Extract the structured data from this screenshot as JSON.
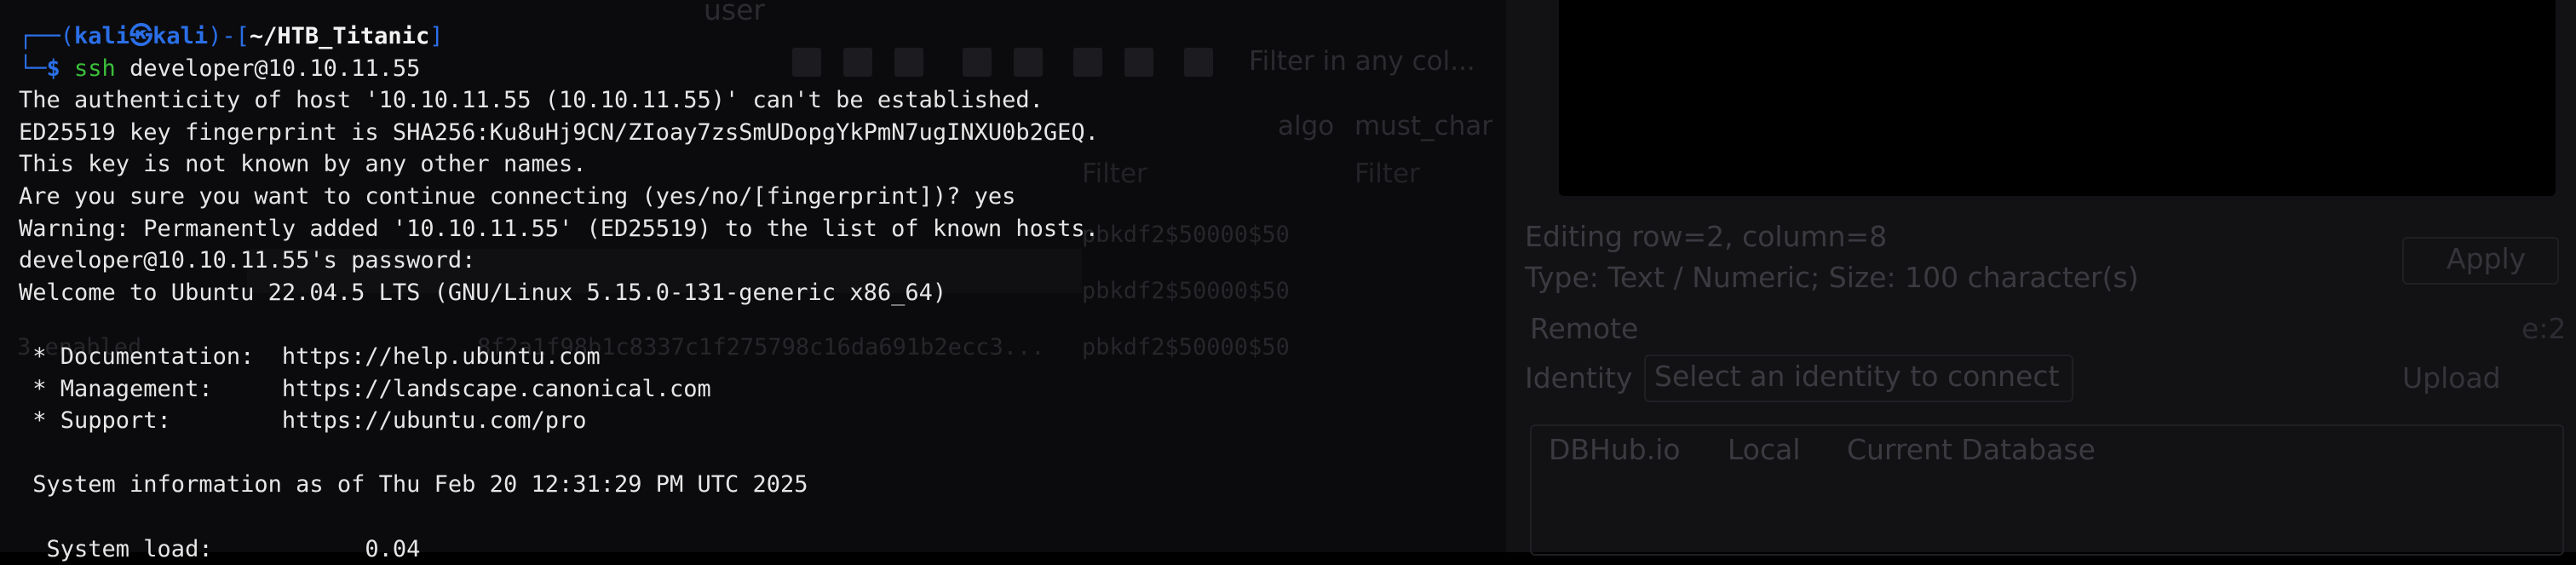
{
  "background_app": {
    "header_user": "user",
    "filter_placeholder": "Filter in any col...",
    "col_algo": "algo",
    "col_must_change": "must_char",
    "filter_cell_1": "Filter",
    "filter_cell_2": "Filter",
    "hash_1": "pbkdf2$50000$50",
    "hash_2": "pbkdf2$50000$50",
    "hash_3": "pbkdf2$50000$50",
    "hex_value": "8f2a1f98b1c8337c1f275798c16da691b2ecc3...",
    "row_label": "3 enabled",
    "editing_status": "Editing row=2, column=8",
    "type_info": "Type: Text / Numeric; Size: 100 character(s)",
    "apply_button": "Apply",
    "remote_label": "Remote",
    "identity_label": "Identity",
    "identity_select": "Select an identity to connect",
    "upload_button": "Upload",
    "tab_dbhub": "DBHub.io",
    "tab_local": "Local",
    "tab_current": "Current Database",
    "side_hint": "e:2"
  },
  "terminal": {
    "prompt": {
      "open": "┌──(",
      "user": "kali",
      "at": "㉿",
      "host": "kali",
      "sep": ")-[",
      "path": "~/HTB_Titanic",
      "close": "]",
      "line2_prefix": "└─",
      "dollar": "$ ",
      "cmd_bin": "ssh",
      "cmd_args": " developer@10.10.11.55"
    },
    "lines": [
      "The authenticity of host '10.10.11.55 (10.10.11.55)' can't be established.",
      "ED25519 key fingerprint is SHA256:Ku8uHj9CN/ZIoay7zsSmUDopgYkPmN7ugINXU0b2GEQ.",
      "This key is not known by any other names.",
      "Are you sure you want to continue connecting (yes/no/[fingerprint])? yes",
      "Warning: Permanently added '10.10.11.55' (ED25519) to the list of known hosts.",
      "developer@10.10.11.55's password:",
      "Welcome to Ubuntu 22.04.5 LTS (GNU/Linux 5.15.0-131-generic x86_64)",
      "",
      " * Documentation:  https://help.ubuntu.com",
      " * Management:     https://landscape.canonical.com",
      " * Support:        https://ubuntu.com/pro",
      "",
      " System information as of Thu Feb 20 12:31:29 PM UTC 2025",
      "",
      "  System load:           0.04"
    ]
  }
}
